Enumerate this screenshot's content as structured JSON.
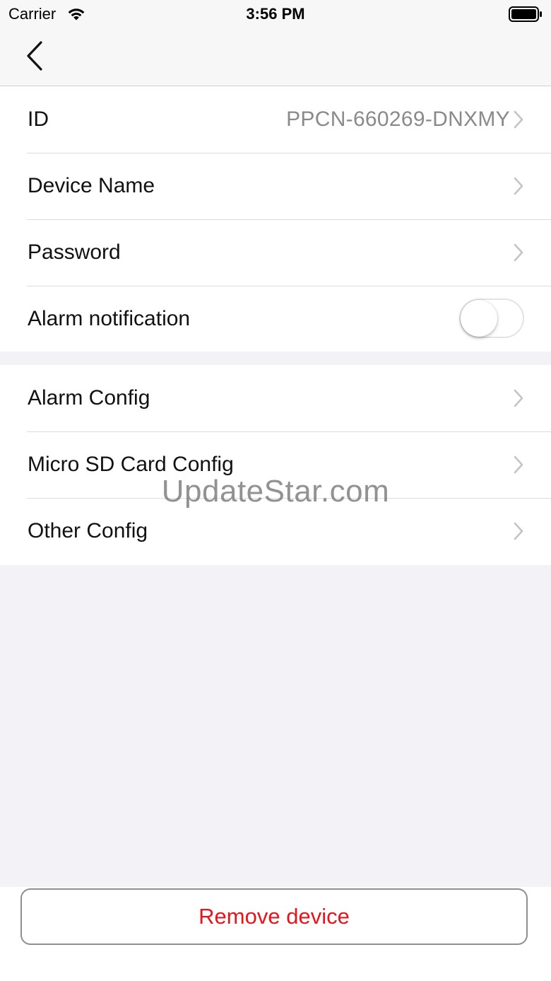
{
  "status_bar": {
    "carrier": "Carrier",
    "time": "3:56 PM",
    "wifi_icon": "wifi-icon",
    "battery_icon": "battery-icon"
  },
  "nav": {
    "back_icon": "chevron-left-icon"
  },
  "settings": {
    "group1": [
      {
        "label": "ID",
        "value": "PPCN-660269-DNXMY"
      },
      {
        "label": "Device Name"
      },
      {
        "label": "Password"
      },
      {
        "label": "Alarm notification",
        "toggle": false
      }
    ],
    "group2": [
      {
        "label": "Alarm Config"
      },
      {
        "label": "Micro SD Card Config"
      },
      {
        "label": "Other Config"
      }
    ]
  },
  "watermark": "UpdateStar.com",
  "footer": {
    "remove_label": "Remove device"
  },
  "colors": {
    "danger": "#e8141c",
    "secondary_text": "#8a8a8e",
    "background": "#f2f2f7"
  }
}
